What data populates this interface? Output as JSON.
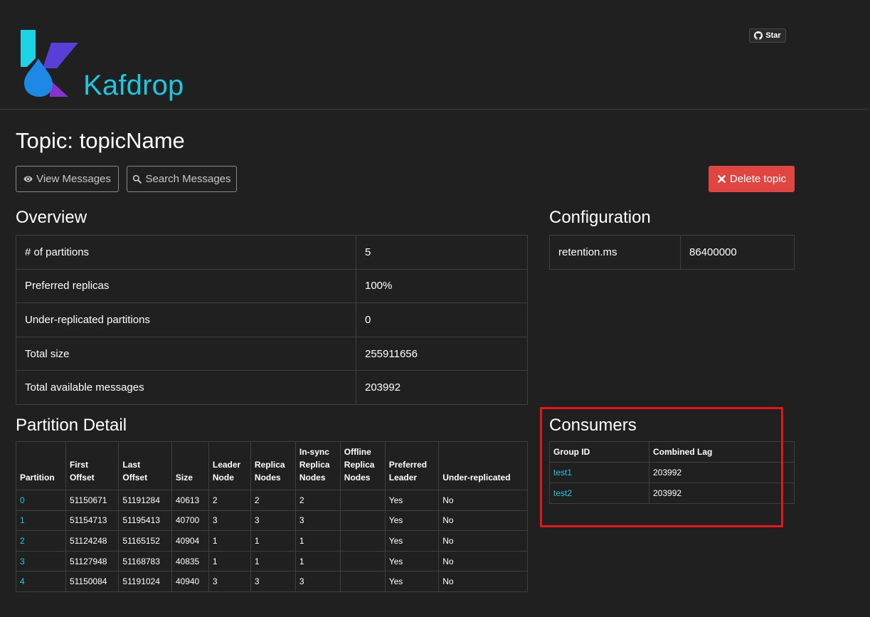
{
  "brand": {
    "name": "Kafdrop"
  },
  "github": {
    "star_label": "Star"
  },
  "page": {
    "title": "Topic: topicName",
    "view_messages_label": "View Messages",
    "search_messages_label": "Search Messages",
    "delete_topic_label": "Delete topic"
  },
  "overview": {
    "title": "Overview",
    "rows": [
      {
        "label": "# of partitions",
        "value": "5"
      },
      {
        "label": "Preferred replicas",
        "value": "100%"
      },
      {
        "label": "Under-replicated partitions",
        "value": "0"
      },
      {
        "label": "Total size",
        "value": "255911656"
      },
      {
        "label": "Total available messages",
        "value": "203992"
      }
    ]
  },
  "configuration": {
    "title": "Configuration",
    "rows": [
      {
        "label": "retention.ms",
        "value": "86400000"
      }
    ]
  },
  "partition_detail": {
    "title": "Partition Detail",
    "headers": [
      [
        "Partition"
      ],
      [
        "First",
        "Offset"
      ],
      [
        "Last",
        "Offset"
      ],
      [
        "Size"
      ],
      [
        "Leader",
        "Node"
      ],
      [
        "Replica",
        "Nodes"
      ],
      [
        "In-sync",
        "Replica",
        "Nodes"
      ],
      [
        "Offline",
        "Replica",
        "Nodes"
      ],
      [
        "Preferred",
        "Leader"
      ],
      [
        "Under-replicated"
      ]
    ],
    "rows": [
      [
        "0",
        "51150671",
        "51191284",
        "40613",
        "2",
        "2",
        "2",
        "",
        "Yes",
        "No"
      ],
      [
        "1",
        "51154713",
        "51195413",
        "40700",
        "3",
        "3",
        "3",
        "",
        "Yes",
        "No"
      ],
      [
        "2",
        "51124248",
        "51165152",
        "40904",
        "1",
        "1",
        "1",
        "",
        "Yes",
        "No"
      ],
      [
        "3",
        "51127948",
        "51168783",
        "40835",
        "1",
        "1",
        "1",
        "",
        "Yes",
        "No"
      ],
      [
        "4",
        "51150084",
        "51191024",
        "40940",
        "3",
        "3",
        "3",
        "",
        "Yes",
        "No"
      ]
    ]
  },
  "consumers": {
    "title": "Consumers",
    "headers": [
      "Group ID",
      "Combined Lag"
    ],
    "rows": [
      {
        "group_id": "test1",
        "combined_lag": "203992"
      },
      {
        "group_id": "test2",
        "combined_lag": "203992"
      }
    ]
  },
  "colors": {
    "background": "#202020",
    "accent": "#1fc6e0",
    "danger": "#e04541",
    "highlight": "#e8141a"
  },
  "icons": [
    "kafdrop-logo",
    "github-icon",
    "eye-icon",
    "search-icon",
    "times-icon"
  ]
}
